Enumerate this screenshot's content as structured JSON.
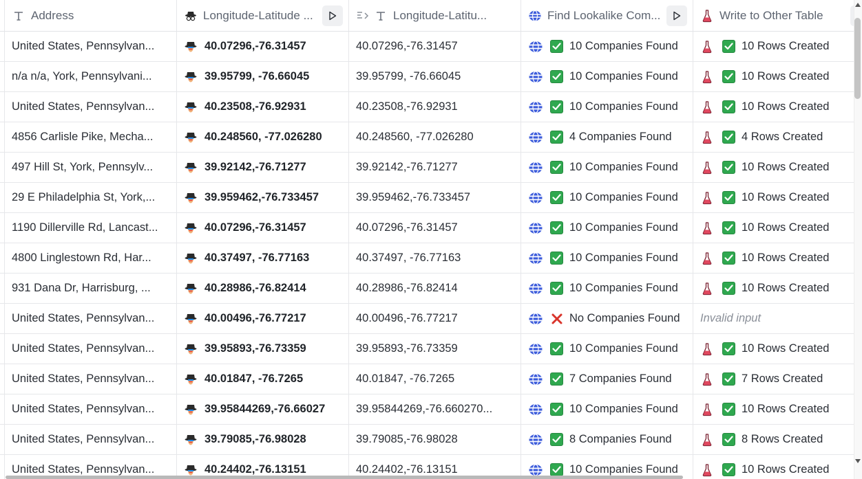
{
  "columns": [
    {
      "label": "Address",
      "icon": "text-type-icon"
    },
    {
      "label": "Longitude-Latitude ...",
      "icon": "spy-hat-icon",
      "run_button": true
    },
    {
      "label": "Longitude-Latitu...",
      "icon": "formula-text-icon"
    },
    {
      "label": "Find Lookalike Com...",
      "icon": "globe-stack-icon",
      "run_button": true
    },
    {
      "label": "Write to Other Table",
      "icon": "flask-icon",
      "run_button": true
    }
  ],
  "rows": [
    {
      "address": "United States, Pennsylvan...",
      "coord": "40.07296,-76.31457",
      "coord_text": "40.07296,-76.31457",
      "lookalike": "10 Companies Found",
      "lookalike_ok": true,
      "write": "10 Rows Created",
      "write_ok": true
    },
    {
      "address": "n/a n/a, York, Pennsylvani...",
      "coord": "39.95799, -76.66045",
      "coord_text": "39.95799, -76.66045",
      "lookalike": "10 Companies Found",
      "lookalike_ok": true,
      "write": "10 Rows Created",
      "write_ok": true
    },
    {
      "address": "United States, Pennsylvan...",
      "coord": "40.23508,-76.92931",
      "coord_text": "40.23508,-76.92931",
      "lookalike": "10 Companies Found",
      "lookalike_ok": true,
      "write": "10 Rows Created",
      "write_ok": true
    },
    {
      "address": "4856 Carlisle Pike, Mecha...",
      "coord": "40.248560, -77.026280",
      "coord_text": "40.248560, -77.026280",
      "lookalike": "4 Companies Found",
      "lookalike_ok": true,
      "write": "4 Rows Created",
      "write_ok": true
    },
    {
      "address": "497 Hill St, York, Pennsylv...",
      "coord": "39.92142,-76.71277",
      "coord_text": "39.92142,-76.71277",
      "lookalike": "10 Companies Found",
      "lookalike_ok": true,
      "write": "10 Rows Created",
      "write_ok": true
    },
    {
      "address": "29 E Philadelphia St, York,...",
      "coord": "39.959462,-76.733457",
      "coord_text": "39.959462,-76.733457",
      "lookalike": "10 Companies Found",
      "lookalike_ok": true,
      "write": "10 Rows Created",
      "write_ok": true
    },
    {
      "address": "1190 Dillerville Rd, Lancast...",
      "coord": "40.07296,-76.31457",
      "coord_text": "40.07296,-76.31457",
      "lookalike": "10 Companies Found",
      "lookalike_ok": true,
      "write": "10 Rows Created",
      "write_ok": true
    },
    {
      "address": "4800 Linglestown Rd, Har...",
      "coord": "40.37497, -76.77163",
      "coord_text": "40.37497, -76.77163",
      "lookalike": "10 Companies Found",
      "lookalike_ok": true,
      "write": "10 Rows Created",
      "write_ok": true
    },
    {
      "address": "931 Dana Dr, Harrisburg, ...",
      "coord": "40.28986,-76.82414",
      "coord_text": "40.28986,-76.82414",
      "lookalike": "10 Companies Found",
      "lookalike_ok": true,
      "write": "10 Rows Created",
      "write_ok": true
    },
    {
      "address": "United States, Pennsylvan...",
      "coord": "40.00496,-76.77217",
      "coord_text": "40.00496,-76.77217",
      "lookalike": "No Companies Found",
      "lookalike_ok": false,
      "write": "Invalid input",
      "write_ok": false
    },
    {
      "address": "United States, Pennsylvan...",
      "coord": "39.95893,-76.73359",
      "coord_text": "39.95893,-76.73359",
      "lookalike": "10 Companies Found",
      "lookalike_ok": true,
      "write": "10 Rows Created",
      "write_ok": true
    },
    {
      "address": "United States, Pennsylvan...",
      "coord": "40.01847, -76.7265",
      "coord_text": "40.01847, -76.7265",
      "lookalike": "7 Companies Found",
      "lookalike_ok": true,
      "write": "7 Rows Created",
      "write_ok": true
    },
    {
      "address": "United States, Pennsylvan...",
      "coord": "39.95844269,-76.66027",
      "coord_text": "39.95844269,-76.660270...",
      "lookalike": "10 Companies Found",
      "lookalike_ok": true,
      "write": "10 Rows Created",
      "write_ok": true
    },
    {
      "address": "United States, Pennsylvan...",
      "coord": "39.79085,-76.98028",
      "coord_text": "39.79085,-76.98028",
      "lookalike": "8 Companies Found",
      "lookalike_ok": true,
      "write": "8 Rows Created",
      "write_ok": true
    },
    {
      "address": "United States, Pennsylvan...",
      "coord": "40.24402,-76.13151",
      "coord_text": "40.24402,-76.13151",
      "lookalike": "10 Companies Found",
      "lookalike_ok": true,
      "write": "10 Rows Created",
      "write_ok": true
    }
  ],
  "colors": {
    "check_green": "#2fa84f",
    "cross_red": "#d9342b",
    "globe_blue": "#3b5bdb",
    "flask_red": "#d9485f",
    "border": "#e6e7ea"
  }
}
